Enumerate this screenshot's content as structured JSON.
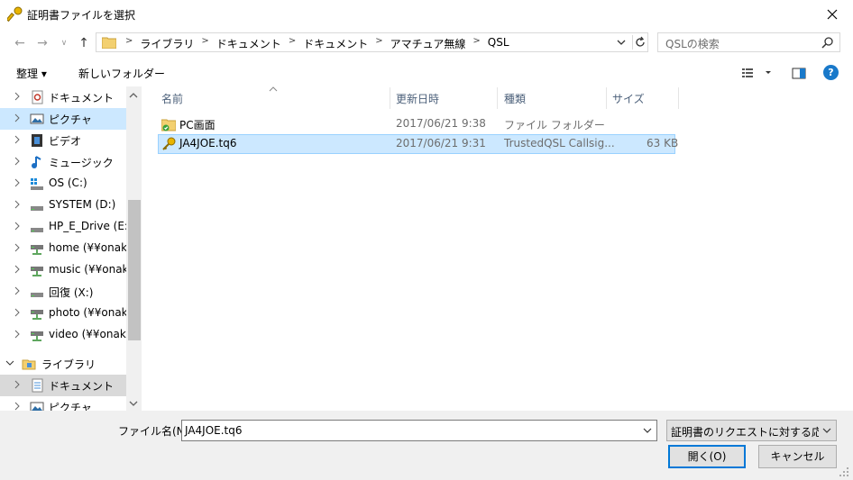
{
  "window": {
    "title": "証明書ファイルを選択"
  },
  "address": {
    "crumbs": [
      "ライブラリ",
      "ドキュメント",
      "ドキュメント",
      "アマチュア無線",
      "QSL"
    ]
  },
  "search": {
    "placeholder": "QSLの検索"
  },
  "toolbar": {
    "organize_label": "整理 ▾",
    "new_folder_label": "新しいフォルダー"
  },
  "nav": {
    "items": [
      {
        "label": "ドキュメント",
        "icon": "documents-icon"
      },
      {
        "label": "ピクチャ",
        "icon": "pictures-icon"
      },
      {
        "label": "ビデオ",
        "icon": "videos-icon"
      },
      {
        "label": "ミュージック",
        "icon": "music-icon"
      },
      {
        "label": "OS (C:)",
        "icon": "drive-icon"
      },
      {
        "label": "SYSTEM (D:)",
        "icon": "drive-icon"
      },
      {
        "label": "HP_E_Drive (E:)",
        "icon": "drive-icon"
      },
      {
        "label": "home (¥¥onaka_",
        "icon": "network-drive-icon"
      },
      {
        "label": "music (¥¥onaka_",
        "icon": "network-drive-icon"
      },
      {
        "label": "回復 (X:)",
        "icon": "drive-icon"
      },
      {
        "label": "photo (¥¥onaka_",
        "icon": "network-drive-icon"
      },
      {
        "label": "video (¥¥onaka_",
        "icon": "network-drive-icon"
      },
      {
        "label": "ライブラリ",
        "icon": "library-icon"
      },
      {
        "label": "ドキュメント",
        "icon": "documents-icon"
      },
      {
        "label": "ピクチャ",
        "icon": "pictures-icon"
      }
    ]
  },
  "columns": {
    "name": "名前",
    "date": "更新日時",
    "type": "種類",
    "size": "サイズ"
  },
  "files": [
    {
      "name": "PC画面",
      "date": "2017/06/21 9:38",
      "type": "ファイル フォルダー",
      "size": ""
    },
    {
      "name": "JA4JOE.tq6",
      "date": "2017/06/21 9:31",
      "type": "TrustedQSL Callsig...",
      "size": "63 KB"
    }
  ],
  "bottom": {
    "filename_label": "ファイル名(N):",
    "filename_value": "JA4JOE.tq6",
    "filetype_value": "証明書のリクエストに対する応答ファ",
    "open_label": "開く(O)",
    "cancel_label": "キャンセル"
  },
  "colors": {
    "selection": "#cce8ff",
    "accent": "#0078d7"
  }
}
